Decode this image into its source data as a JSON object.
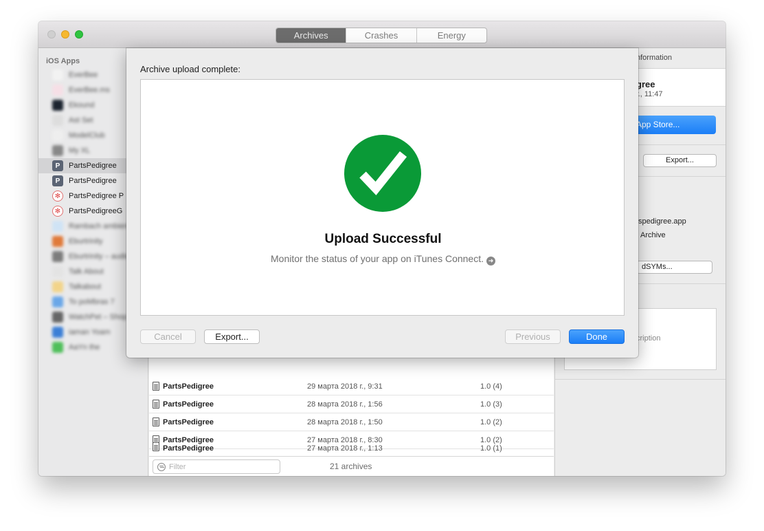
{
  "tabs": {
    "archives": "Archives",
    "crashes": "Crashes",
    "energy": "Energy"
  },
  "sidebar": {
    "header": "iOS Apps",
    "items": [
      {
        "label": "EverBee"
      },
      {
        "label": "EverBee.ms"
      },
      {
        "label": "Ekound"
      },
      {
        "label": "Ast Set"
      },
      {
        "label": "ModelClub"
      },
      {
        "label": "My XL"
      },
      {
        "label": "PartsPedigree"
      },
      {
        "label": "PartsPedigree"
      },
      {
        "label": "PartsPedigree P"
      },
      {
        "label": "PartsPedigreeG"
      },
      {
        "label": "Rambach ambient"
      },
      {
        "label": "Eburtrinity"
      },
      {
        "label": "Eburtrinity – audio"
      },
      {
        "label": "Talk About"
      },
      {
        "label": "Talkabout"
      },
      {
        "label": "To poMbras 7"
      },
      {
        "label": "WatchPet – Shop"
      },
      {
        "label": "iaman Yoam"
      },
      {
        "label": "AaYn the"
      }
    ]
  },
  "archives": {
    "rows": [
      {
        "name": "PartsPedigree",
        "date": "29 марта 2018 г., 9:31",
        "version": "1.0 (4)"
      },
      {
        "name": "PartsPedigree",
        "date": "28 марта 2018 г., 1:56",
        "version": "1.0 (3)"
      },
      {
        "name": "PartsPedigree",
        "date": "28 марта 2018 г., 1:50",
        "version": "1.0 (2)"
      },
      {
        "name": "PartsPedigree",
        "date": "27 марта 2018 г., 8:30",
        "version": "1.0 (2)"
      },
      {
        "name": "PartsPedigree",
        "date": "27 марта 2018 г., 1:13",
        "version": "1.0 (1)"
      }
    ],
    "filter_placeholder": "Filter",
    "count": "21 archives"
  },
  "inspector": {
    "section_header": "nformation",
    "name": "gree",
    "date": "г., 11:47",
    "upload_button": "App Store...",
    "export_button": "Export...",
    "identifier": "tspedigree.app",
    "type": "Archive",
    "dsyms_button": "dSYMs...",
    "description_placeholder": "cription"
  },
  "sheet": {
    "title": "Archive upload complete:",
    "success_title": "Upload Successful",
    "success_subtitle": "Monitor the status of your app on iTunes Connect.",
    "cancel": "Cancel",
    "export": "Export...",
    "previous": "Previous",
    "done": "Done"
  },
  "colors": {
    "success_green": "#0a9a37",
    "accent_blue": "#1b7ef7"
  }
}
